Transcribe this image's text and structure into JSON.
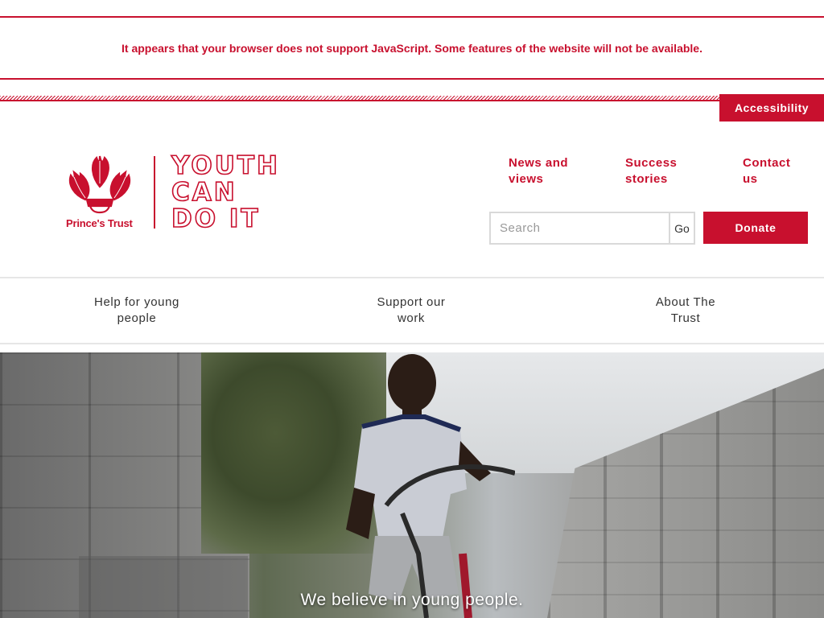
{
  "js_warning": "It appears that your browser does not support JavaScript. Some features of the website will not be available.",
  "accessibility_label": "Accessibility",
  "logo": {
    "org_name": "Prince's Trust",
    "tagline_lines": [
      "YOUTH",
      "CAN",
      "DO IT"
    ]
  },
  "top_links": [
    {
      "line1": "News and",
      "line2": "views"
    },
    {
      "line1": "Success",
      "line2": "stories"
    },
    {
      "line1": "Contact",
      "line2": "us"
    }
  ],
  "search": {
    "placeholder": "Search",
    "go_label": "Go"
  },
  "donate_label": "Donate",
  "main_nav": [
    {
      "line1": "Help for young",
      "line2": "people"
    },
    {
      "line1": "Support our",
      "line2": "work"
    },
    {
      "line1": "About The",
      "line2": "Trust"
    }
  ],
  "hero": {
    "caption": "We believe in young people."
  },
  "colors": {
    "brand_red": "#c8102e",
    "nav_text": "#333333",
    "divider": "#e6e6e6"
  },
  "icons": {
    "crest": "prince-of-wales-feathers-icon"
  }
}
